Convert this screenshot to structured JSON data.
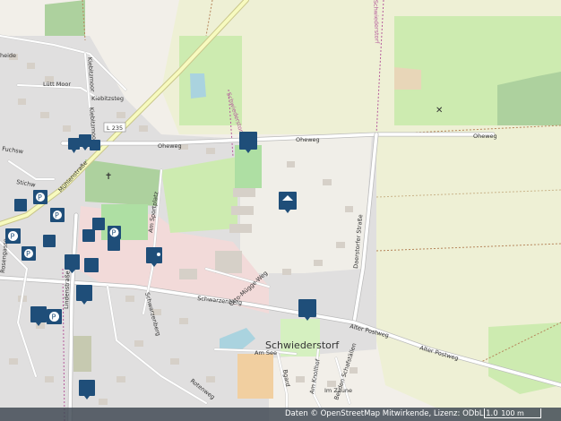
{
  "map": {
    "labels": {
      "oheweg_1": "Oheweg",
      "oheweg_2": "Oheweg",
      "l235": "L 235",
      "schwiederstorf": "Schwiederstorf",
      "schwiederstorf_road": "Schwiederstorf",
      "luetmoor": "Lütt Moor",
      "kiebitzsteg": "Kiebitzsteg",
      "kiebitzmoor": "Kiebitzmoor",
      "muehlenstrasse": "Mühlenstraße",
      "lindenstrasse": "Lindenstraße",
      "am_sportplatz": "Am Sportplatz",
      "schwarzenberg_1": "Schwarzenberg",
      "schwarzenberg_2": "Schwarzenberg",
      "otto_mugge_weg": "Otto-Mügge-Weg",
      "daerstorfer_strasse": "Daerstorfer Straße",
      "alter_postweg_1": "Alter Postweg",
      "alter_postweg_2": "Alter Postweg",
      "am_see": "Am See",
      "am_knollhof": "Am Knollhof",
      "bei_den_schafstaellen": "Bei den Schafställen",
      "im_zaune": "Im Zaune",
      "rotenweg": "Rotenweg",
      "ohe_weg_left": "Ohe",
      "heide": "heide",
      "stichweg": "Stichw",
      "fuchsweg": "Fuchsw",
      "bgard": "Bgard",
      "rosengasse": "Rosengasse"
    },
    "colors": {
      "background": "#f2efe9",
      "farmland": "#eef0d5",
      "meadow": "#cdebb0",
      "forest": "#add19e",
      "residential": "#e0dfdf",
      "retail": "#f2dad9",
      "water": "#aad3df",
      "poi": "#1f4e79",
      "trunk": "#f7fabf"
    },
    "pois": [
      {
        "icon": "tram-icon"
      },
      {
        "icon": "bus-icon"
      },
      {
        "icon": "bus-icon"
      },
      {
        "icon": "parking-icon"
      },
      {
        "icon": "parking-icon"
      },
      {
        "icon": "parking-icon"
      },
      {
        "icon": "parking-icon"
      },
      {
        "icon": "parking-icon"
      },
      {
        "icon": "bus-icon"
      },
      {
        "icon": "shop-icon"
      },
      {
        "icon": "bakery-icon"
      },
      {
        "icon": "cafe-icon"
      },
      {
        "icon": "fitness-icon"
      },
      {
        "icon": "hotel-icon"
      },
      {
        "icon": "fuel-icon"
      },
      {
        "icon": "ticket-icon"
      },
      {
        "icon": "bus-icon"
      },
      {
        "icon": "basket-icon"
      },
      {
        "icon": "parking-icon"
      },
      {
        "icon": "car-icon"
      },
      {
        "icon": "home-icon"
      }
    ]
  },
  "footer": {
    "attribution": "Daten © OpenStreetMap Mitwirkende, Lizenz: ODbL 1.0",
    "scale": "100 m"
  }
}
